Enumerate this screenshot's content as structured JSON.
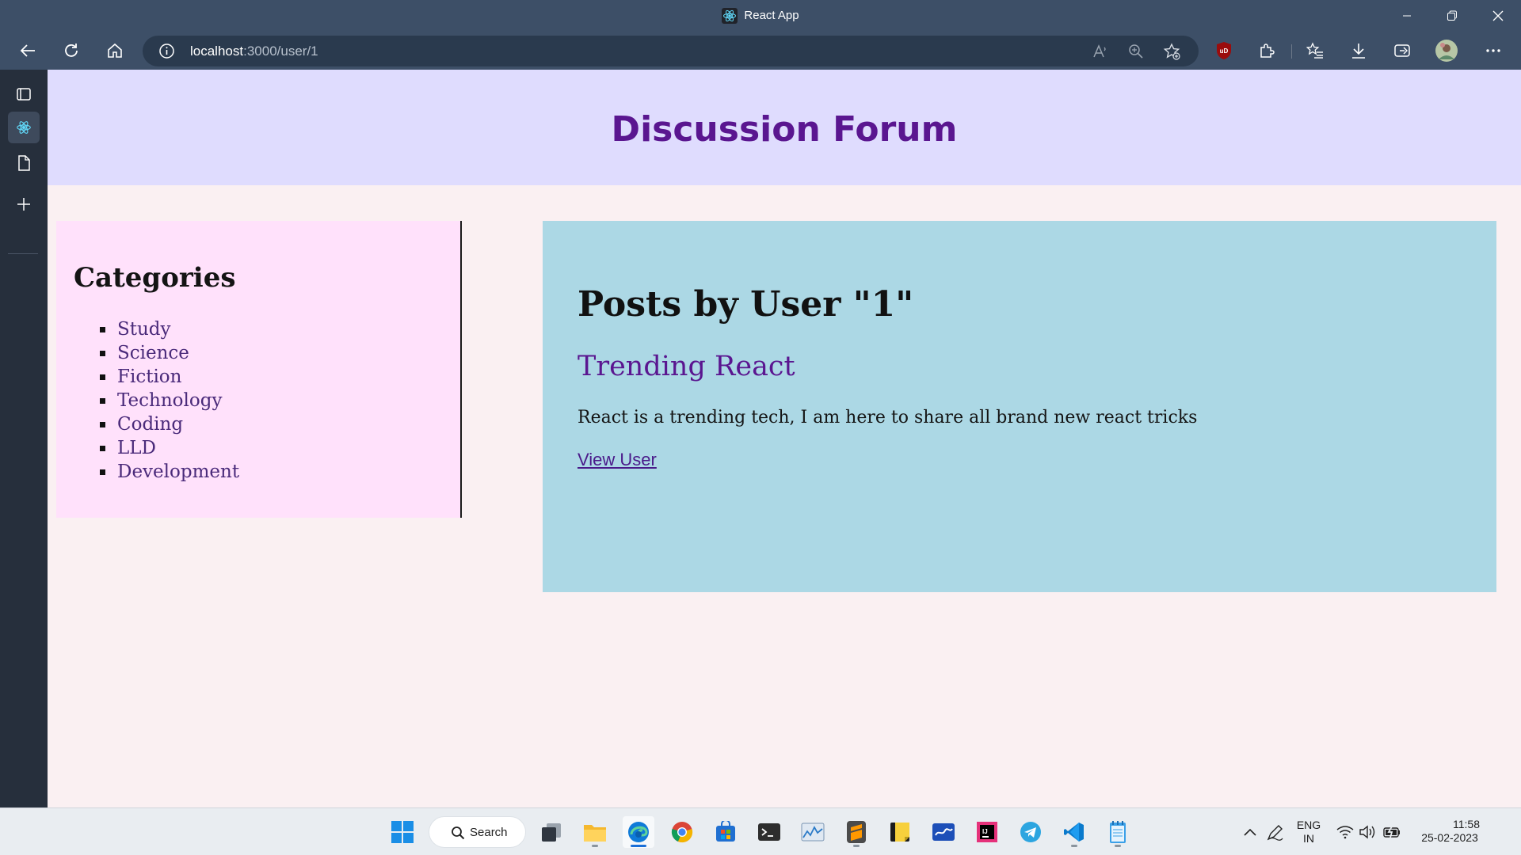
{
  "browser": {
    "title": "React App",
    "url_host": "localhost",
    "url_path": ":3000/user/1"
  },
  "page": {
    "header_title": "Discussion Forum",
    "categories": {
      "heading": "Categories",
      "items": [
        "Study",
        "Science",
        "Fiction",
        "Technology",
        "Coding",
        "LLD",
        "Development"
      ]
    },
    "posts": {
      "heading": "Posts by User \"1\"",
      "post": {
        "title": "Trending React",
        "body": "React is a trending tech, I am here to share all brand new react tricks",
        "link": "View User"
      }
    }
  },
  "taskbar": {
    "search_label": "Search",
    "lang_top": "ENG",
    "lang_bottom": "IN",
    "time": "11:58",
    "date": "25-02-2023"
  },
  "colors": {
    "header_bg": "#dfdcfe",
    "header_text": "#5a1690",
    "categories_bg": "#ffe1fb",
    "posts_bg": "#acd8e5",
    "page_bg": "#faf0f2"
  }
}
